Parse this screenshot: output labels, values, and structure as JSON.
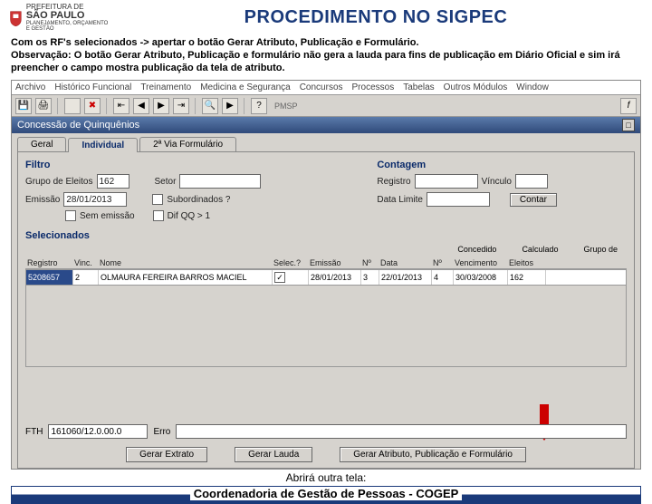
{
  "header": {
    "prefeitura_top": "PREFEITURA DE",
    "prefeitura_mid": "SÃO PAULO",
    "prefeitura_bot": "PLANEJAMENTO, ORÇAMENTO E GESTÃO",
    "title": "PROCEDIMENTO NO SIGPEC"
  },
  "intro": {
    "line1a": "Com os RF's selecionados -> apertar o botão Gerar Atributo, Publicação e Formulário.",
    "line2a": "Observação: O botão Gerar Atributo, Publicação e formulário não gera a lauda para fins de publicação em Diário Oficial e sim irá preencher o campo mostra publicação da tela de atributo."
  },
  "menubar": [
    "Archivo",
    "Histórico Funcional",
    "Treinamento",
    "Medicina e Segurança",
    "Concursos",
    "Processos",
    "Tabelas",
    "Outros Módulos",
    "Window"
  ],
  "toolbar": {
    "pmsp": "PMSP"
  },
  "window_title": "Concessão de Quinquênios",
  "tabs": {
    "geral": "Geral",
    "individual": "Individual",
    "via2": "2ª Via Formulário"
  },
  "filtro": {
    "head": "Filtro",
    "grupo_label": "Grupo de Eleitos",
    "grupo_val": "162",
    "setor_label": "Setor",
    "emissao_label": "Emissão",
    "emissao_val": "28/01/2013",
    "subordinados": "Subordinados ?",
    "sem_emissao": "Sem emissão",
    "dif_qq": "Dif QQ > 1"
  },
  "contagem": {
    "head": "Contagem",
    "registro_label": "Registro",
    "vinculo_label": "Vínculo",
    "data_limite_label": "Data Limite",
    "contar_btn": "Contar"
  },
  "grid": {
    "selecionados": "Selecionados",
    "top_right": {
      "concedido": "Concedido",
      "calculado": "Calculado",
      "grupo_de": "Grupo de"
    },
    "cols": {
      "registro": "Registro",
      "vinc": "Vinc.",
      "nome": "Nome",
      "selec": "Selec.?",
      "emissao": "Emissão",
      "n1": "Nº",
      "data": "Data",
      "n2": "Nº",
      "vencimento": "Vencimento",
      "eleitos": "Eleitos"
    },
    "row": {
      "registro": "5208657",
      "vinc": "2",
      "nome": "OLMAURA FEREIRA BARROS MACIEL",
      "selec_checked": true,
      "emissao": "28/01/2013",
      "n1": "3",
      "data": "22/01/2013",
      "n2": "4",
      "vencimento": "30/03/2008",
      "eleitos": "162"
    }
  },
  "foot": {
    "fth_label": "FTH",
    "fth_val": "161060/12.0.00.0",
    "erro_label": "Erro"
  },
  "actions": {
    "extrato": "Gerar Extrato",
    "lauda": "Gerar Lauda",
    "atributo": "Gerar Atributo, Publicação e Formulário"
  },
  "footer": {
    "abrirá": "Abrirá outra tela:",
    "cogep": "Coordenadoria de Gestão de Pessoas - COGEP"
  }
}
